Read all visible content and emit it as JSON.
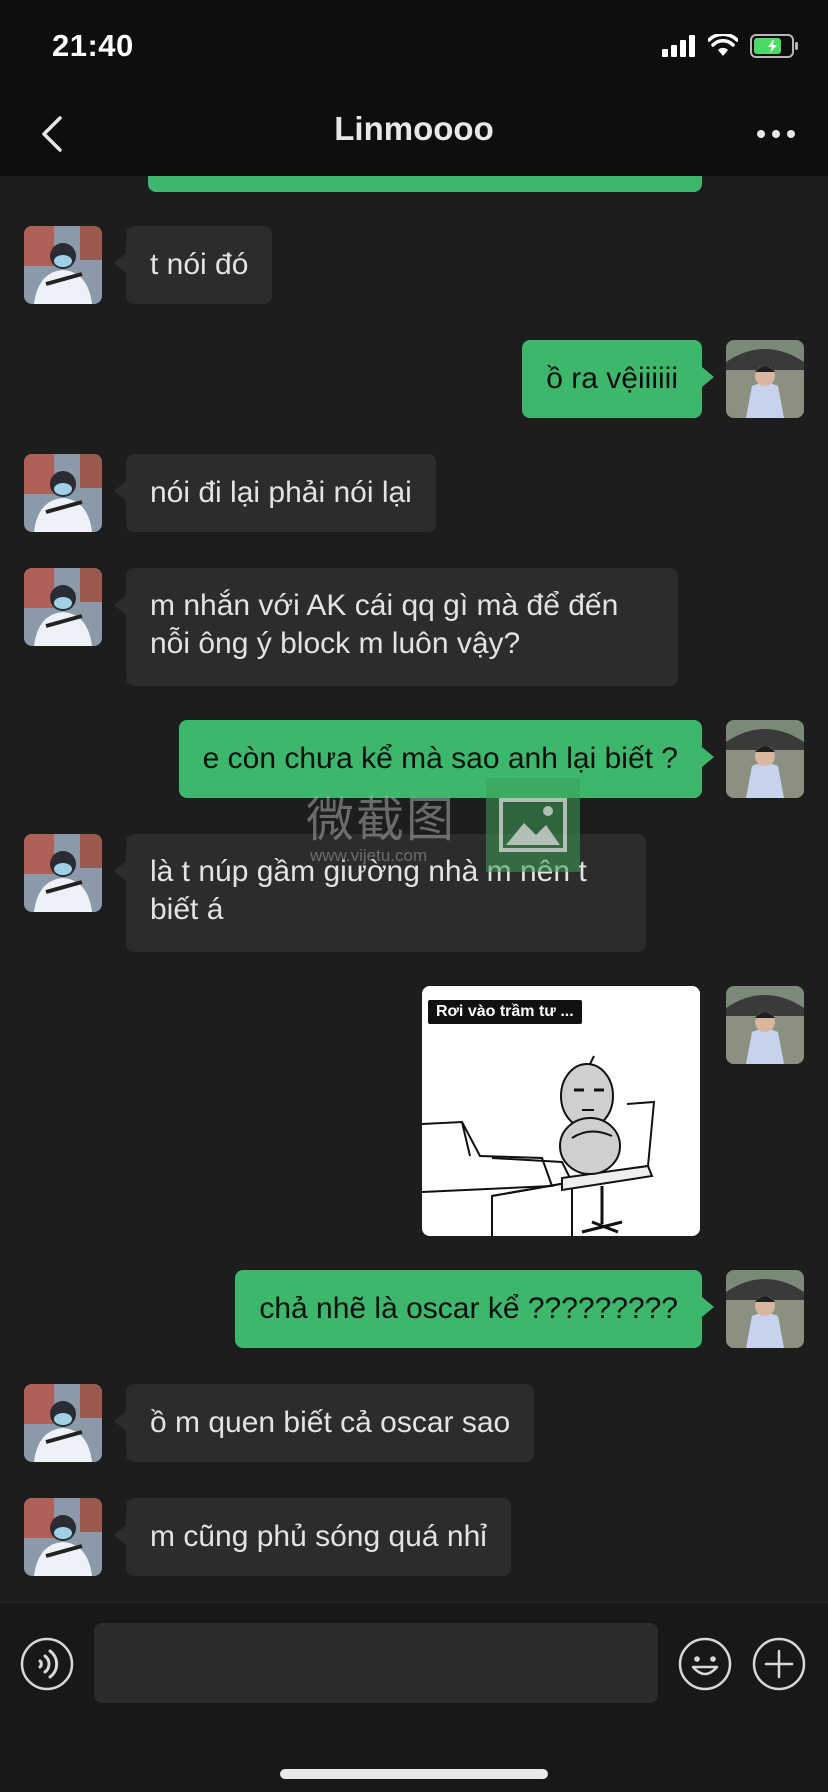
{
  "status_bar": {
    "time": "21:40"
  },
  "header": {
    "title": "Linmoooo"
  },
  "messages": [
    {
      "side": "in",
      "type": "text",
      "text": "t nói đó"
    },
    {
      "side": "out",
      "type": "text",
      "text": "ồ ra vệiiiiii"
    },
    {
      "side": "in",
      "type": "text",
      "text": "nói đi lại phải nói lại"
    },
    {
      "side": "in",
      "type": "text",
      "line1": "m nhắn với AK cái qq gì mà để đến",
      "line2": "nỗi ông ý block m luôn vậy?"
    },
    {
      "side": "out",
      "type": "text",
      "text": "e còn chưa kể mà sao anh lại biết ?"
    },
    {
      "side": "in",
      "type": "text",
      "line1": "là t núp gầm giường nhà m nên t",
      "line2": "biết á"
    },
    {
      "side": "out",
      "type": "sticker",
      "caption": "Rơi vào trầm tư ..."
    },
    {
      "side": "out",
      "type": "text",
      "text": "chả nhẽ là oscar kể ?????????"
    },
    {
      "side": "in",
      "type": "text",
      "text": "ồ m quen biết cả oscar sao"
    },
    {
      "side": "in",
      "type": "text",
      "text": "m cũng phủ sóng quá nhỉ"
    }
  ],
  "watermark": {
    "text": "微截图",
    "url": "www.vijetu.com"
  },
  "input_bar": {
    "value": "",
    "placeholder": ""
  },
  "colors": {
    "outgoing_bubble": "#3db76b",
    "incoming_bubble": "#2c2c2c",
    "background": "#1d1d1d"
  },
  "icons": [
    "back-chevron-icon",
    "more-dots-icon",
    "voice-icon",
    "emoji-icon",
    "plus-icon",
    "signal-icon",
    "wifi-icon",
    "battery-icon"
  ]
}
